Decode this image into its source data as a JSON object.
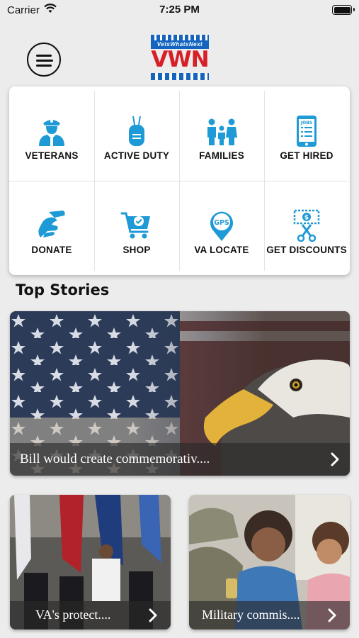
{
  "status": {
    "carrier": "Carrier",
    "time": "7:25 PM"
  },
  "header": {
    "logo_tag": "VetsWhatsNext",
    "logo_text": "VWN"
  },
  "grid": [
    {
      "label": "VETERANS",
      "icon": "soldier-icon"
    },
    {
      "label": "ACTIVE DUTY",
      "icon": "dog-tag-icon"
    },
    {
      "label": "FAMILIES",
      "icon": "family-icon"
    },
    {
      "label": "GET HIRED",
      "icon": "jobs-phone-icon"
    },
    {
      "label": "DONATE",
      "icon": "donate-hand-icon"
    },
    {
      "label": "SHOP",
      "icon": "cart-icon"
    },
    {
      "label": "VA LOCATE",
      "icon": "gps-pin-icon"
    },
    {
      "label": "GET DISCOUNTS",
      "icon": "coupon-icon"
    }
  ],
  "icon_color": "#1e9ad6",
  "section_title": "Top Stories",
  "stories": [
    {
      "caption": "Bill would create commemorativ...."
    },
    {
      "caption": "VA's protect...."
    },
    {
      "caption": "Military commis...."
    }
  ]
}
